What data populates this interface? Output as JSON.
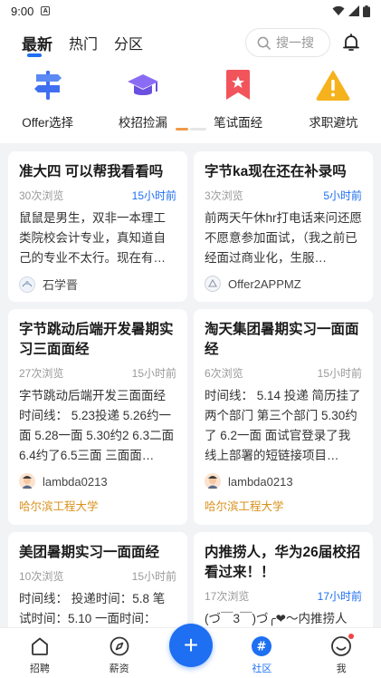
{
  "status_bar": {
    "time": "9:00",
    "a_badge": "A"
  },
  "header": {
    "tabs": [
      {
        "label": "最新"
      },
      {
        "label": "热门"
      },
      {
        "label": "分区"
      }
    ],
    "search_placeholder": "搜一搜"
  },
  "categories": [
    {
      "label": "Offer选择",
      "icon": "signpost-icon",
      "color": "#3f6ff0"
    },
    {
      "label": "校招捡漏",
      "icon": "graduation-cap-icon",
      "color": "#7a5cf0"
    },
    {
      "label": "笔试面经",
      "icon": "bookmark-star-icon",
      "color": "#f2545b"
    },
    {
      "label": "求职避坑",
      "icon": "warning-icon",
      "color": "#f5b21c"
    }
  ],
  "posts": [
    {
      "title": "准大四 可以帮我看看吗",
      "views": "30次浏览",
      "time": "15小时前",
      "time_highlight": true,
      "body": "鼠鼠是男生，双非一本理工类院校会计专业，真知道自己的专业不太行。现在有…",
      "author": "石学晋",
      "school": ""
    },
    {
      "title": "字节ka现在还在补录吗",
      "views": "3次浏览",
      "time": "5小时前",
      "time_highlight": true,
      "body": "前两天午休hr打电话来问还愿不愿意参加面试，（我之前已经面过商业化，生服…",
      "author": "Offer2APPMZ",
      "school": ""
    },
    {
      "title": "字节跳动后端开发暑期实习三面面经",
      "views": "27次浏览",
      "time": "15小时前",
      "time_highlight": false,
      "body": "字节跳动后端开发三面面经 时间线： 5.23投递 5.26约一面 5.28一面 5.30约2 6.3二面 6.4约了6.5三面 三面面…",
      "author": "lambda0213",
      "school": "哈尔滨工程大学"
    },
    {
      "title": "淘天集团暑期实习一面面经",
      "views": "6次浏览",
      "time": "15小时前",
      "time_highlight": false,
      "body": "时间线： 5.14 投递 简历挂了两个部门 第三个部门 5.30约了 6.2一面 面试官登录了我线上部署的短链接项目…",
      "author": "lambda0213",
      "school": "哈尔滨工程大学"
    },
    {
      "title": "美团暑期实习一面面经",
      "views": "10次浏览",
      "time": "15小时前",
      "time_highlight": false,
      "body": "时间线： 投递时间：5.8 笔试时间：5.10 一面时间：",
      "author": "",
      "school": ""
    },
    {
      "title": "内推捞人，华为26届校招看过来！！",
      "views": "17次浏览",
      "time": "17小时前",
      "time_highlight": true,
      "body": "(づ￣3￣)づ╭❤～内推捞人",
      "author": "",
      "school": ""
    }
  ],
  "bottom_nav": [
    {
      "label": "招聘",
      "icon": "home-icon"
    },
    {
      "label": "薪资",
      "icon": "compass-icon"
    },
    {
      "label": "社区",
      "icon": "community-hash-icon"
    },
    {
      "label": "我",
      "icon": "profile-face-icon"
    }
  ],
  "fab_symbol": "+",
  "colors": {
    "accent": "#1e6ff1",
    "school": "#d9911c"
  }
}
